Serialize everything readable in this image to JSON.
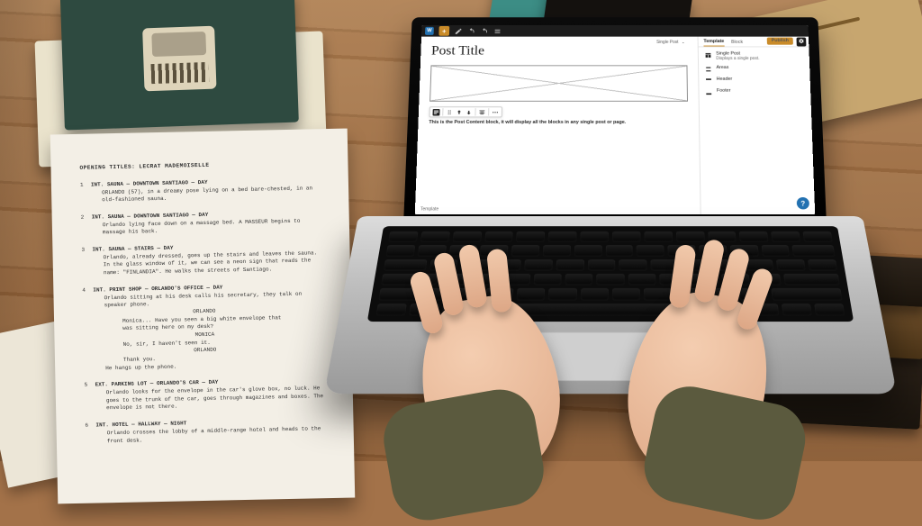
{
  "editor": {
    "post_title": "Post Title",
    "breadcrumb": "Single Post",
    "content_block_note": "This is the Post Content block, it will display all the blocks in any single post or page.",
    "status_bar": "Template",
    "help_label": "?",
    "topbar": {
      "plus_label": "+"
    },
    "sidebar": {
      "tab_template": "Template",
      "tab_block": "Block",
      "publish": "Publish",
      "template_name": "Single Post",
      "template_desc": "Displays a single post.",
      "areas_label": "Areas",
      "header_label": "Header",
      "footer_label": "Footer"
    }
  },
  "script_page": {
    "title": "OPENING TITLES: LECRAT MADEMOISELLE",
    "scenes": [
      {
        "n": "1",
        "slug": "INT. SAUNA — DOWNTOWN SANTIAGO — DAY",
        "action": "ORLANDO (57), in a dreamy pose lying on a bed bare-chested, in an old-fashioned sauna."
      },
      {
        "n": "2",
        "slug": "INT. SAUNA — DOWNTOWN SANTIAGO — DAY",
        "action": "Orlando lying face down on a massage bed. A MASSEUR begins to massage his back."
      },
      {
        "n": "3",
        "slug": "INT. SAUNA — STAIRS — DAY",
        "action": "Orlando, already dressed, goes up the stairs and leaves the sauna. In the glass window of it, we can see a neon sign that reads the name: \"FINLANDIA\". He walks the streets of Santiago."
      },
      {
        "n": "4",
        "slug": "INT. PRINT SHOP — ORLANDO'S OFFICE — DAY",
        "action": "Orlando sitting at his desk calls his secretary, they talk on speaker phone.",
        "dialogue": [
          {
            "char": "ORLANDO",
            "line": "Monica... Have you seen a big white envelope that was sitting here on my desk?"
          },
          {
            "char": "MONICA",
            "line": "No, sir, I haven't seen it."
          },
          {
            "char": "ORLANDO",
            "line": "Thank you."
          }
        ],
        "tail": "He hangs up the phone."
      },
      {
        "n": "5",
        "slug": "EXT. PARKING LOT — ORLANDO'S CAR — DAY",
        "action": "Orlando looks for the envelope in the car's glove box, no luck. He goes to the trunk of the car, goes through magazines and boxes. The envelope is not there."
      },
      {
        "n": "6",
        "slug": "INT. HOTEL — HALLWAY — NIGHT",
        "action": "Orlando crosses the lobby of a middle-range hotel and heads to the front desk."
      }
    ]
  }
}
